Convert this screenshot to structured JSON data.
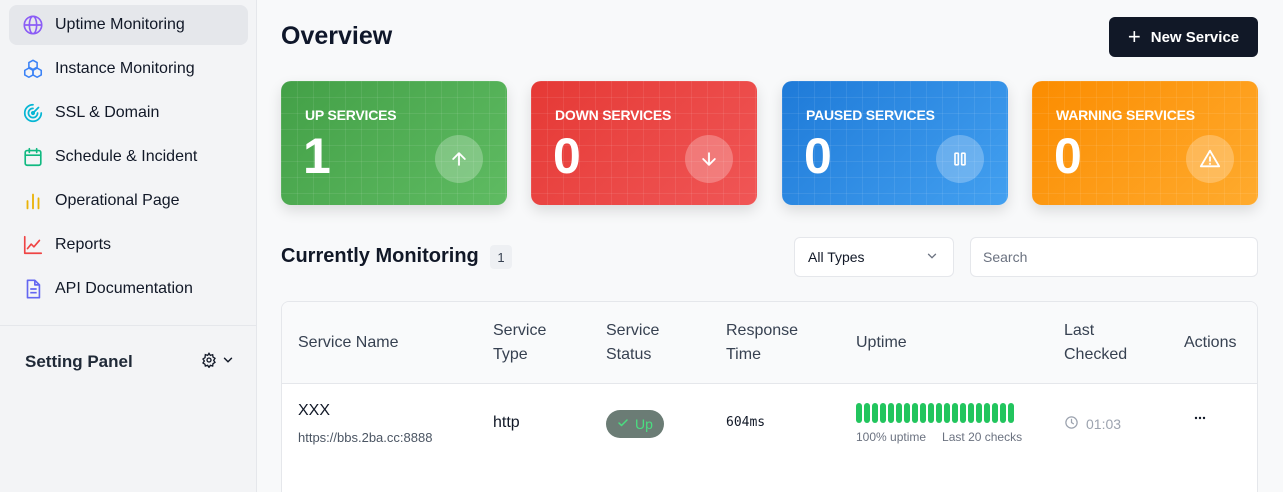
{
  "sidebar": {
    "items": [
      {
        "label": "Uptime Monitoring",
        "icon": "globe-icon",
        "color": "#8b5cf6",
        "active": true
      },
      {
        "label": "Instance Monitoring",
        "icon": "cubes-icon",
        "color": "#3b82f6"
      },
      {
        "label": "SSL & Domain",
        "icon": "radar-icon",
        "color": "#06b6d4"
      },
      {
        "label": "Schedule & Incident",
        "icon": "calendar-icon",
        "color": "#10b981"
      },
      {
        "label": "Operational Page",
        "icon": "bar-chart-icon",
        "color": "#eab308"
      },
      {
        "label": "Reports",
        "icon": "line-chart-icon",
        "color": "#ef4444"
      },
      {
        "label": "API Documentation",
        "icon": "document-icon",
        "color": "#6366f1"
      }
    ],
    "setting_panel": {
      "label": "Setting Panel"
    }
  },
  "header": {
    "title": "Overview",
    "new_button": "New Service",
    "new_button_icon": "plus-icon"
  },
  "stats": {
    "up": {
      "label": "UP SERVICES",
      "value": "1",
      "icon": "arrow-up-icon",
      "color": "#4caf50"
    },
    "down": {
      "label": "DOWN SERVICES",
      "value": "0",
      "icon": "arrow-down-icon",
      "color": "#e53935"
    },
    "paused": {
      "label": "PAUSED SERVICES",
      "value": "0",
      "icon": "pause-icon",
      "color": "#2b8be6"
    },
    "warning": {
      "label": "WARNING SERVICES",
      "value": "0",
      "icon": "warning-icon",
      "color": "#ff9800"
    }
  },
  "monitoring": {
    "title": "Currently Monitoring",
    "count": "1",
    "type_filter": "All Types",
    "search_placeholder": "Search",
    "columns": [
      "Service Name",
      "Service Type",
      "Service Status",
      "Response Time",
      "Uptime",
      "Last Checked",
      "Actions"
    ],
    "rows": [
      {
        "name": "XXX",
        "url": "https://bbs.2ba.cc:8888",
        "type": "http",
        "status": "Up",
        "response_time": "604ms",
        "uptime_label": "100% uptime",
        "checks_label": "Last 20 checks",
        "checks_up": 20,
        "last_checked": "01:03"
      }
    ]
  }
}
